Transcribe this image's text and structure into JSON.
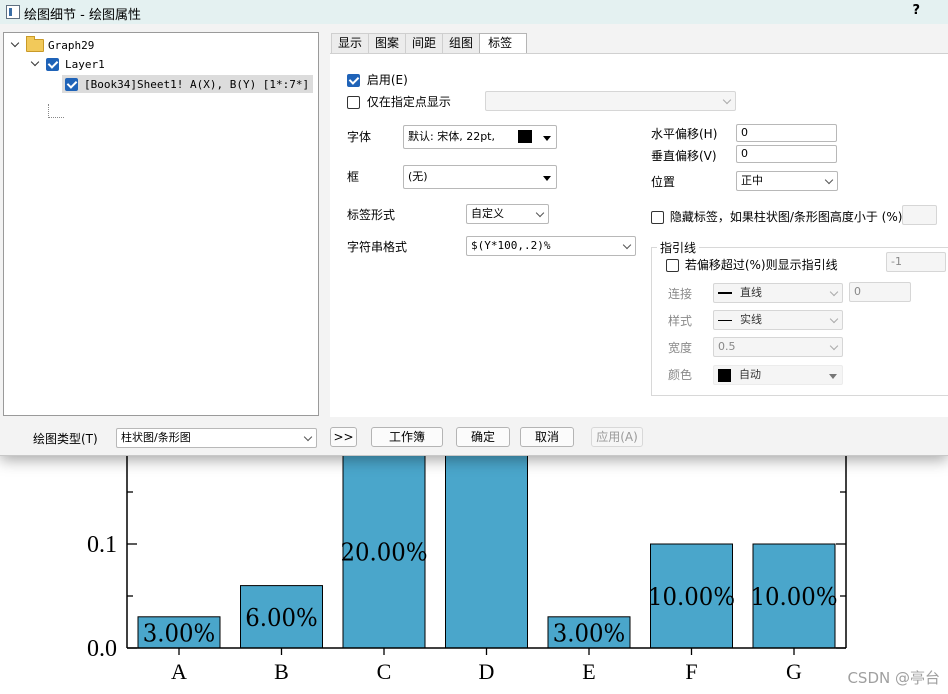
{
  "window": {
    "title": "绘图细节 - 绘图属性",
    "help": "?"
  },
  "tree": {
    "root": "Graph29",
    "layer": "Layer1",
    "plot": "[Book34]Sheet1! A(X), B(Y) [1*:7*]"
  },
  "tabs": [
    "显示",
    "图案",
    "间距",
    "组图",
    "标签"
  ],
  "active_tab": "标签",
  "label_tab": {
    "enable_label": "启用(E)",
    "only_at_points_label": "仅在指定点显示",
    "font_label": "字体",
    "font_value": "默认: 宋体, 22pt,",
    "font_color": "#000000",
    "frame_label": "框",
    "frame_value": "(无)",
    "form_label": "标签形式",
    "form_value": "自定义",
    "string_format_label": "字符串格式",
    "string_format_value": "$(Y*100,.2)%",
    "x_offset_label": "水平偏移(H)",
    "x_offset_value": "0",
    "y_offset_label": "垂直偏移(V)",
    "y_offset_value": "0",
    "position_label": "位置",
    "position_value": "正中",
    "hide_label": "隐藏标签，如果柱状图/条形图高度小于 (%)",
    "leader_group_title": "指引线",
    "leader_checkbox": "若偏移超过(%)则显示指引线",
    "leader_threshold": "-1",
    "connect_label": "连接",
    "connect_value": "直线",
    "connect_number": "0",
    "style_label": "样式",
    "style_value": "实线",
    "width_label": "宽度",
    "width_value": "0.5",
    "color_label": "颜色",
    "color_value": "自动"
  },
  "bottom": {
    "plot_type_label": "绘图类型(T)",
    "plot_type_value": "柱状图/条形图",
    "expand": ">>",
    "workbook": "工作簿",
    "ok": "确定",
    "cancel": "取消",
    "apply": "应用(A)"
  },
  "chart_data": {
    "type": "bar",
    "categories": [
      "A",
      "B",
      "C",
      "D",
      "E",
      "F",
      "G"
    ],
    "values": [
      0.03,
      0.06,
      0.2,
      0.35,
      0.03,
      0.1,
      0.1
    ],
    "data_labels": [
      "3.00%",
      "6.00%",
      "20.00%",
      "",
      "3.00%",
      "10.00%",
      "10.00%"
    ],
    "y_ticks": [
      "0.0",
      "0.1"
    ],
    "y_tick_values": [
      0,
      0.1
    ],
    "bar_color": "#4aa6cb",
    "title": "",
    "xlabel": "",
    "ylabel": ""
  },
  "watermark": "CSDN @亭台"
}
